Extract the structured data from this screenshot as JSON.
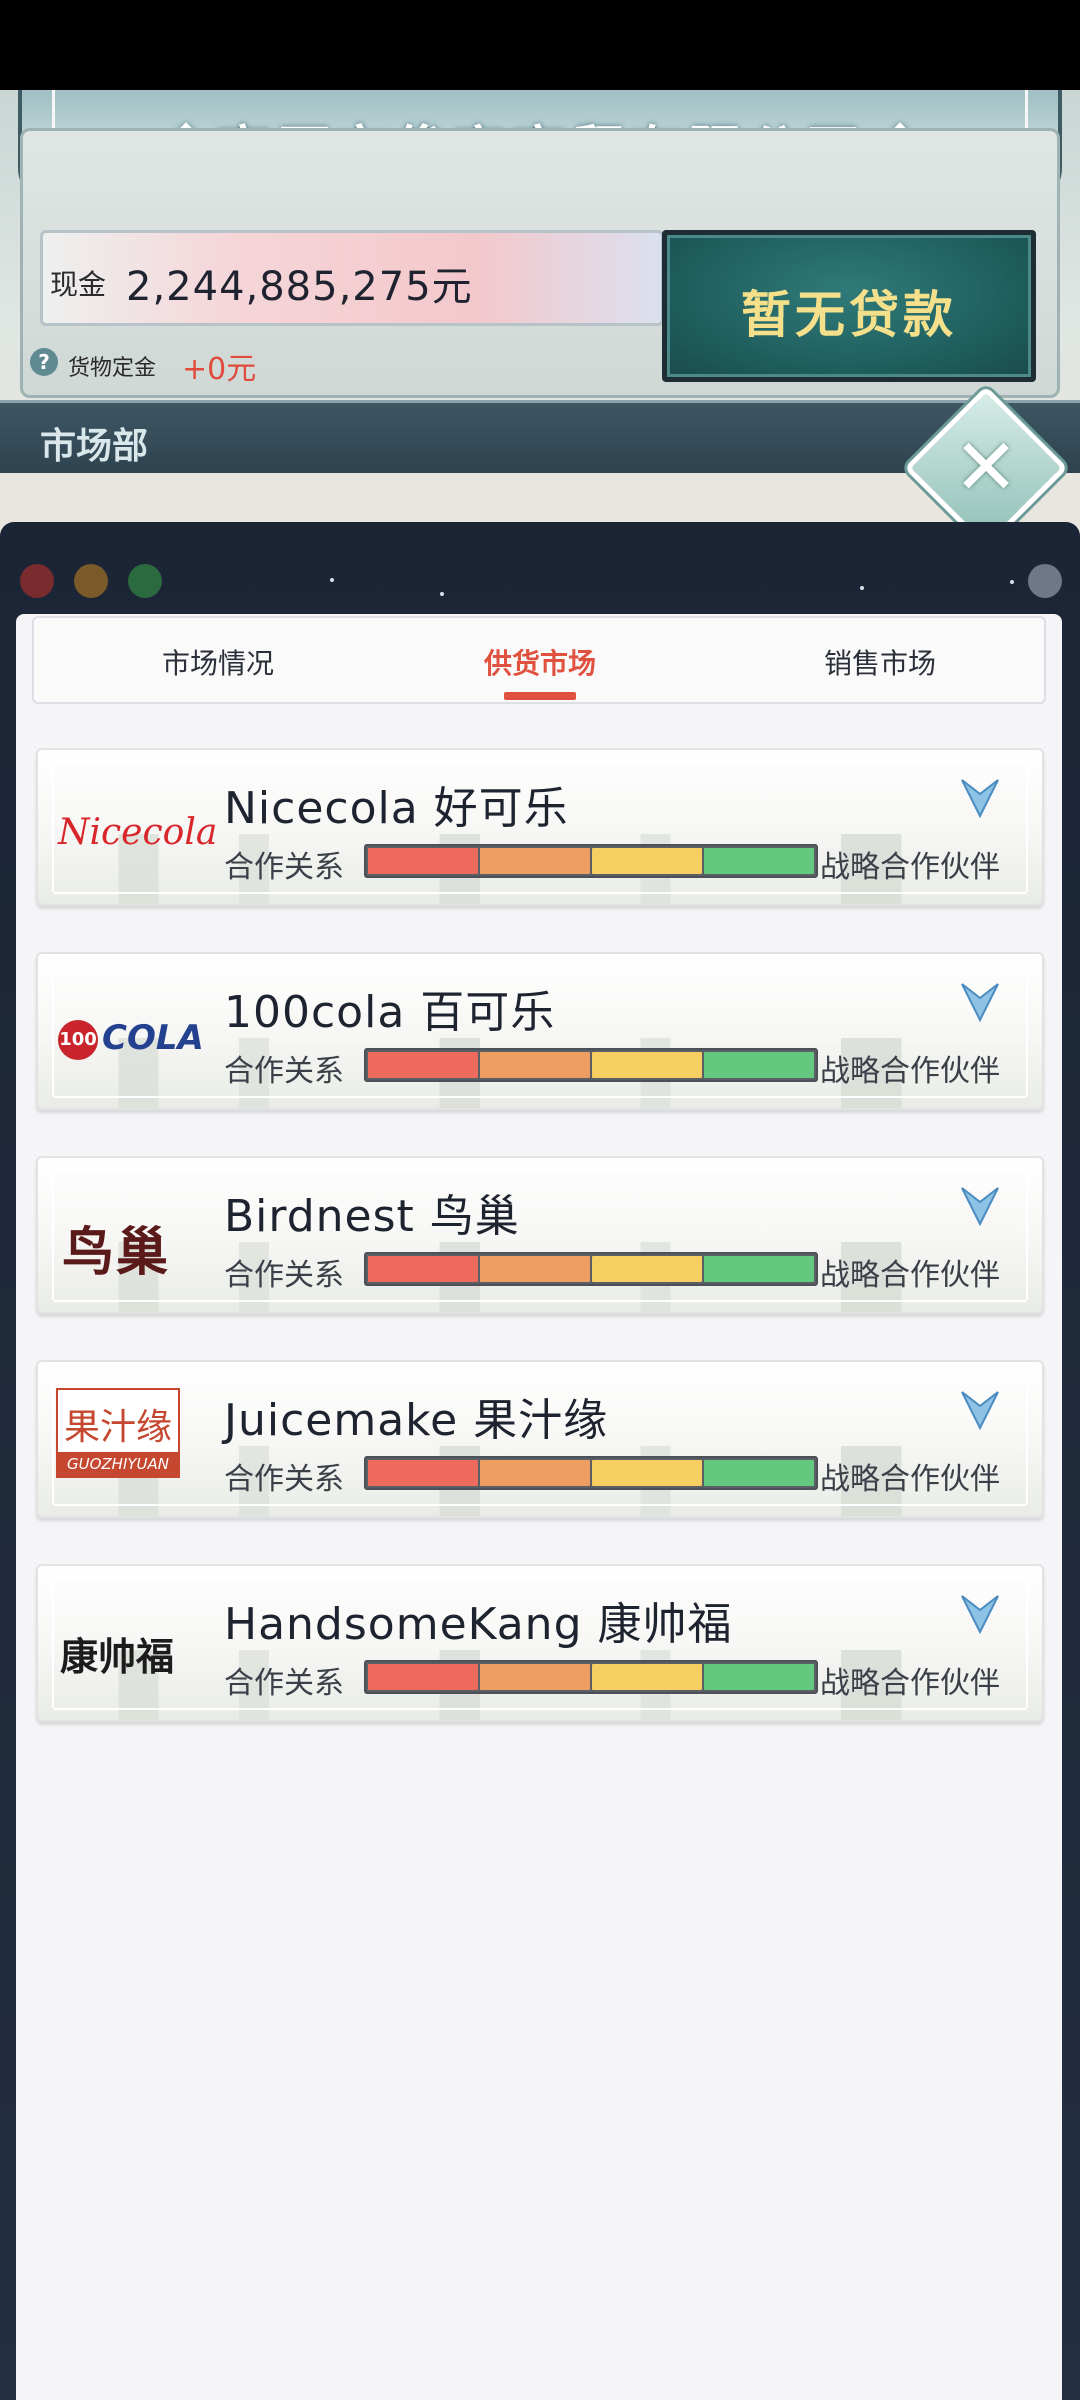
{
  "company": {
    "name": "高原市俊宇商贸有限公司",
    "cash_label": "现金",
    "cash_value": "2,244,885,275元",
    "loan_status": "暂无贷款",
    "deposit_label": "货物定金",
    "deposit_value": "+0元",
    "help_glyph": "?"
  },
  "department": {
    "title": "市场部"
  },
  "close_glyph": "✕",
  "tabs": [
    {
      "label": "市场情况",
      "active": false
    },
    {
      "label": "供货市场",
      "active": true
    },
    {
      "label": "销售市场",
      "active": false
    }
  ],
  "relationship_colors": [
    "#ee6a5c",
    "#ee9e60",
    "#f6ce62",
    "#62c97f"
  ],
  "suppliers": [
    {
      "name": "Nicecola 好可乐",
      "logo_text": "Nicecola",
      "relation_label": "合作关系",
      "relation_status": "战略合作伙伴",
      "relation_level": 1.0
    },
    {
      "name": "100cola 百可乐",
      "logo_text": "100",
      "logo_text2": "COLA",
      "relation_label": "合作关系",
      "relation_status": "战略合作伙伴",
      "relation_level": 1.0
    },
    {
      "name": "Birdnest 鸟巢",
      "logo_text": "鸟巢",
      "relation_label": "合作关系",
      "relation_status": "战略合作伙伴",
      "relation_level": 1.0
    },
    {
      "name": "Juicemake 果汁缘",
      "logo_text": "果汁缘",
      "logo_text2": "GUOZHIYUAN",
      "relation_label": "合作关系",
      "relation_status": "战略合作伙伴",
      "relation_level": 1.0
    },
    {
      "name": "HandsomeKang 康帅福",
      "logo_text": "康帅福",
      "relation_label": "合作关系",
      "relation_status": "战略合作伙伴",
      "relation_level": 1.0
    }
  ]
}
